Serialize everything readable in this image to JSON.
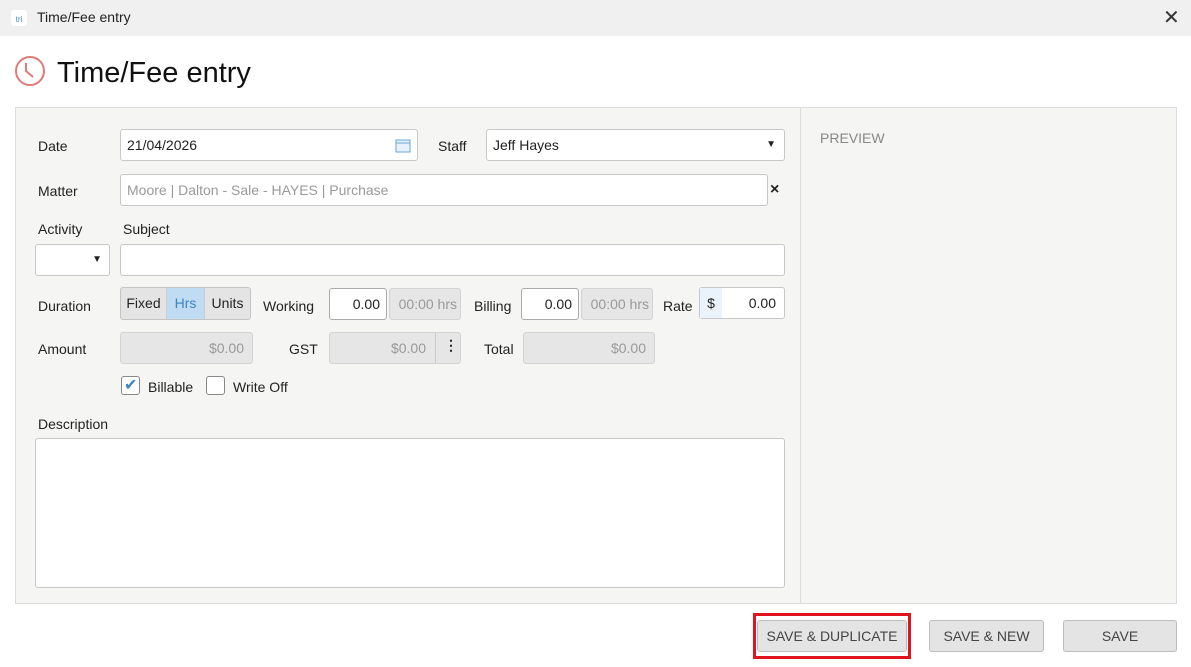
{
  "window": {
    "title": "Time/Fee entry",
    "app_icon": "tri-logo"
  },
  "header": {
    "title": "Time/Fee entry",
    "icon": "clock-icon"
  },
  "form": {
    "date_label": "Date",
    "date_value": "21/04/2026",
    "staff_label": "Staff",
    "staff_value": "Jeff Hayes",
    "matter_label": "Matter",
    "matter_value": "Moore | Dalton - Sale - HAYES | Purchase",
    "activity_label": "Activity",
    "subject_label": "Subject",
    "subject_value": "",
    "duration_label": "Duration",
    "duration_options": [
      "Fixed",
      "Hrs",
      "Units"
    ],
    "duration_selected": "Hrs",
    "working_label": "Working",
    "working_value": "0.00",
    "working_hrs": "00:00 hrs",
    "billing_label": "Billing",
    "billing_value": "0.00",
    "billing_hrs": "00:00 hrs",
    "rate_label": "Rate",
    "rate_currency": "$",
    "rate_value": "0.00",
    "amount_label": "Amount",
    "amount_value": "$0.00",
    "gst_label": "GST",
    "gst_value": "$0.00",
    "total_label": "Total",
    "total_value": "$0.00",
    "billable_label": "Billable",
    "billable_checked": true,
    "writeoff_label": "Write Off",
    "writeoff_checked": false,
    "description_label": "Description",
    "description_value": ""
  },
  "preview": {
    "label": "PREVIEW"
  },
  "footer": {
    "save_duplicate": "SAVE & DUPLICATE",
    "save_new": "SAVE & NEW",
    "save": "SAVE"
  },
  "colors": {
    "accent": "#5aa0e0",
    "highlight": "#e0141e",
    "clock": "#d9534f"
  }
}
